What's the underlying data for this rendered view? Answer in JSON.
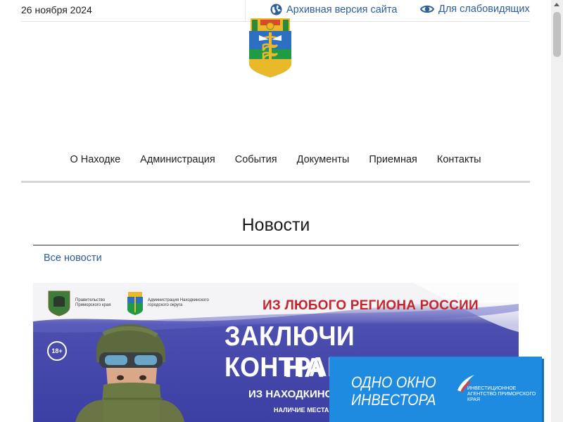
{
  "top": {
    "date": "26 ноября 2024",
    "archive_label": "Архивная версия сайта",
    "vision_label": "Для слабовидящих"
  },
  "nav": {
    "items": [
      "О Находке",
      "Администрация",
      "События",
      "Документы",
      "Приемная",
      "Контакты"
    ]
  },
  "news": {
    "section_title": "Новости",
    "all_news_label": "Все новости"
  },
  "banner": {
    "gov_label": "Правительство Приморского края",
    "admin_label": "Администрация Находкинского городского округа",
    "line1": "ИЗ ЛЮБОГО РЕГИОНА РОССИИ",
    "line2": "ЗАКЛЮЧИ КОНТРАКТ",
    "line3": "НА С",
    "line4": "ИЗ НАХОДКИНС",
    "line5": "НАЛИЧИЕ МЕСТА",
    "age_badge": "18+"
  },
  "invest": {
    "line1": "ОДНО ОКНО",
    "line2": "ИНВЕСТОРА",
    "agency": "ИНВЕСТИЦИОННОЕ АГЕНТСТВО ПРИМОРСКОГО КРАЯ"
  },
  "colors": {
    "link": "#2b5e9a",
    "banner_blue": "#3c3fa3",
    "banner_red": "#c4262e",
    "invest_blue": "#1f8be0"
  }
}
